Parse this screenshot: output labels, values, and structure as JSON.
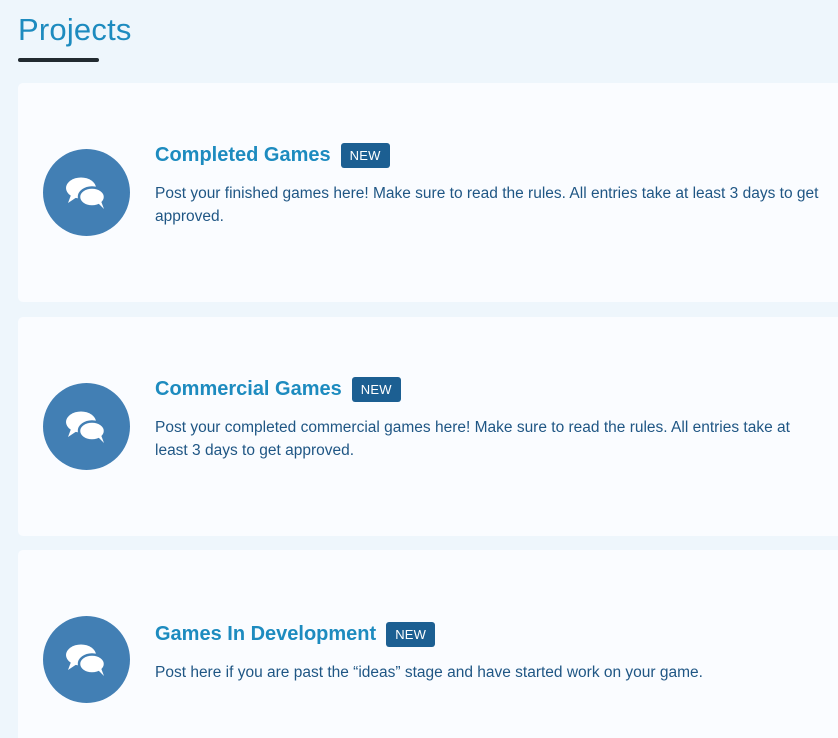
{
  "section": {
    "title": "Projects"
  },
  "forums": [
    {
      "title": "Completed Games",
      "badge": "NEW",
      "description": "Post your finished games here! Make sure to read the rules. All entries take at least 3 days to get approved.",
      "icon": "chat-bubbles-icon"
    },
    {
      "title": "Commercial Games",
      "badge": "NEW",
      "description": "Post your completed commercial games here! Make sure to read the rules. All entries take at least 3 days to get approved.",
      "icon": "chat-bubbles-icon"
    },
    {
      "title": "Games In Development",
      "badge": "NEW",
      "description": "Post here if you are past the “ideas” stage and have started work on your game.",
      "icon": "chat-bubbles-icon"
    }
  ],
  "colors": {
    "accent": "#1d8bbf",
    "icon_bg": "#427fb4",
    "badge_bg": "#1c5f92",
    "text": "#1f5684",
    "page_bg": "#eef6fc",
    "card_bg": "#fafcff"
  }
}
